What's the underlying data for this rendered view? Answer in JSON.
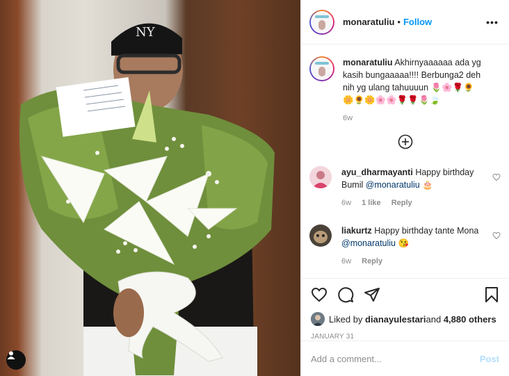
{
  "header": {
    "username": "monaratuliu",
    "separator": "•",
    "follow_label": "Follow",
    "more_label": "•••"
  },
  "caption": {
    "username": "monaratuliu",
    "text": "Akhirnyaaaaaa ada yg kasih bungaaaaa!!!! Berbunga2 deh nih yg ulang tahuuuun 🌷🌸🌹🌻🌼🌻🌼🌸🌸🌹🌹🌷🍃",
    "time": "6w"
  },
  "comments": [
    {
      "username": "ayu_dharmayanti",
      "text": "Happy birthday Bumil ",
      "mention": "@monaratuliu",
      "emoji": "🎂",
      "time": "6w",
      "likes": "1 like",
      "reply_label": "Reply"
    },
    {
      "username": "liakurtz",
      "text": "Happy birthday tante Mona ",
      "mention": "@monaratuliu",
      "emoji": "😘",
      "time": "6w",
      "reply_label": "Reply"
    }
  ],
  "likes": {
    "prefix": "Liked by ",
    "user": "dianayulestari",
    "middle": " and ",
    "others": "4,880 others"
  },
  "date": "January 31",
  "add_comment": {
    "placeholder": "Add a comment...",
    "post_label": "Post"
  },
  "colors": {
    "accent": "#0095f6",
    "post_disabled": "#b2dffc",
    "muted": "#8e8e8e",
    "border": "#efefef"
  },
  "icons": [
    "heart-icon",
    "comment-icon",
    "share-icon",
    "bookmark-icon",
    "add-circle-icon",
    "user-tag-icon",
    "more-icon"
  ]
}
